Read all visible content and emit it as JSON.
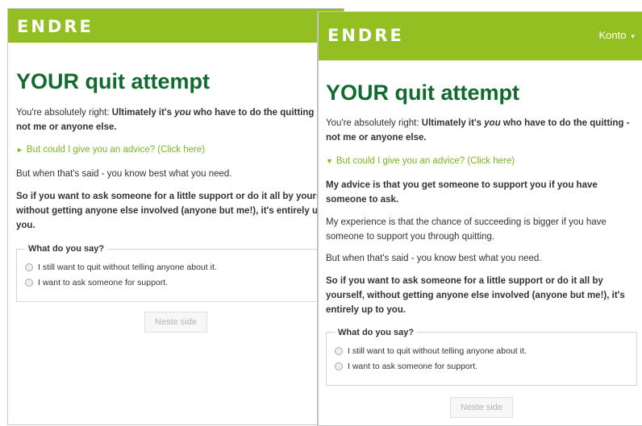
{
  "app": {
    "logo": "ENDRE",
    "account_label": "Konto"
  },
  "page": {
    "title": "YOUR quit attempt",
    "intro_prefix": "You're absolutely right: ",
    "intro_bold_1": "Ultimately it's ",
    "intro_bold_you": "you",
    "intro_bold_2": " who have to do the quitting - not me or anyone else.",
    "advice_toggle_label": "But could I give you an advice? (Click here)",
    "advice_collapsed_arrow": "►",
    "advice_expanded_arrow": "▼",
    "advice_heading": "My advice is that you get someone to support you if you have someone to ask.",
    "advice_detail": "My experience is that the chance of succeeding is bigger if you have someone to support you through quitting.",
    "but_when": "But when that's said - you know best what you need.",
    "closing": "So if you want to ask someone for a little support or do it all by yourself, without getting anyone else involved (anyone but me!), it's entirely up to you.",
    "question_legend": "What do you say?",
    "options": [
      "I still want to quit without telling anyone about it.",
      "I want to ask someone for support."
    ],
    "next_button": "Neste side"
  }
}
